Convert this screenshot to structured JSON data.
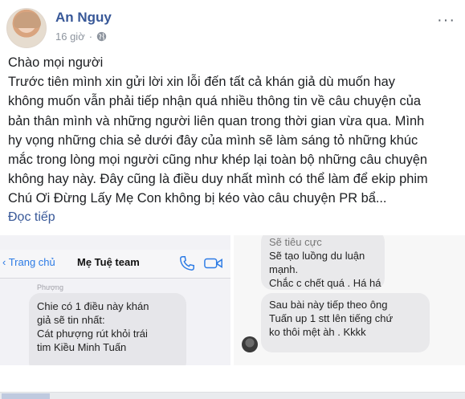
{
  "post": {
    "author": "An Nguy",
    "time": "16 giờ",
    "separator": "·",
    "privacy_icon": "globe-icon",
    "more_label": "···",
    "lines": [
      "Chào mọi người",
      "Trước tiên mình xin gửi lời xin lỗi đến tất cả khán giả dù muốn hay",
      "không muốn vẫn phải tiếp nhận quá nhiều thông tin về câu chuyện của",
      "bản thân mình và những người liên quan trong thời gian vừa qua. Mình",
      "hy vọng những chia sẻ dưới đây của mình sẽ làm sáng tỏ những khúc",
      "mắc trong lòng mọi người cũng như khép lại toàn bộ những câu chuyện",
      "không hay này. Đây cũng là điều duy nhất mình có thể làm để ekip phim",
      "Chú Ơi Đừng Lấy Mẹ Con không bị kéo vào câu chuyện PR bẩ..."
    ],
    "read_more": "Đọc tiếp"
  },
  "screenshot_left": {
    "back_label": "Trang chủ",
    "chat_title": "Mẹ Tuệ team",
    "sender": "Phượng",
    "message_lines": [
      "Chie có 1 điều này khán",
      "giả sẽ tin nhất:",
      "Cát phượng rút khỏi trái",
      "tim Kiều Minh Tuấn"
    ]
  },
  "screenshot_right": {
    "message1_lines": [
      "Sẽ tiêu cực",
      "Sẽ tạo luồng du luận",
      "mạnh.",
      "Chắc c chết quá . Há há"
    ],
    "message2_lines": [
      "Sau bài này tiếp theo ông",
      "Tuấn up 1 stt lên tiếng chứ",
      "ko thôi mệt àh . Kkkk"
    ]
  },
  "colors": {
    "link_blue": "#385898",
    "ios_blue": "#2c7be5",
    "bubble_grey": "#e6e6ea"
  }
}
